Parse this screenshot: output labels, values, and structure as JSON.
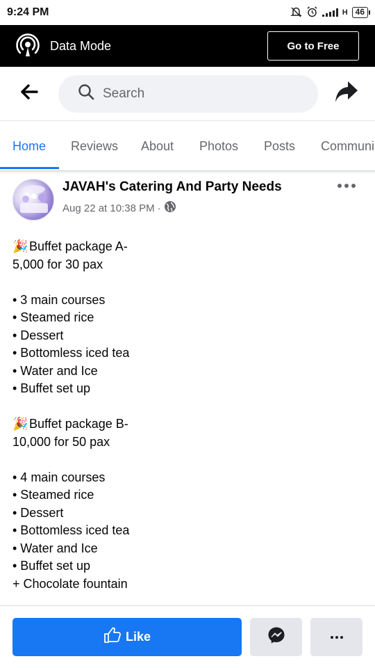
{
  "status_bar": {
    "time": "9:24 PM",
    "network": "H",
    "battery": "46",
    "icons": [
      "notifications-off-icon",
      "alarm-icon",
      "signal-icon"
    ]
  },
  "data_mode": {
    "label": "Data Mode",
    "go_free_label": "Go to Free",
    "icon": "broadcast-icon"
  },
  "nav": {
    "search_placeholder": "Search",
    "back_icon": "back-arrow-icon",
    "share_icon": "share-icon"
  },
  "tabs": [
    {
      "label": "Home",
      "active": true
    },
    {
      "label": "Reviews",
      "active": false
    },
    {
      "label": "About",
      "active": false
    },
    {
      "label": "Photos",
      "active": false
    },
    {
      "label": "Posts",
      "active": false
    },
    {
      "label": "Communi",
      "active": false
    }
  ],
  "post": {
    "author": "JAVAH's Catering And Party Needs",
    "timestamp": "Aug 22 at 10:38 PM",
    "separator": "·",
    "audience_icon": "globe-icon",
    "lines": [
      {
        "emoji": "🎉",
        "text": "Buffet package A-"
      },
      {
        "text": "5,000 for 30 pax"
      },
      {
        "text": ""
      },
      {
        "text": "• 3 main courses"
      },
      {
        "text": "• Steamed rice"
      },
      {
        "text": "• Dessert"
      },
      {
        "text": "• Bottomless iced tea"
      },
      {
        "text": "• Water and Ice"
      },
      {
        "text": "• Buffet set up"
      },
      {
        "text": ""
      },
      {
        "emoji": "🎉",
        "text": "Buffet package B-"
      },
      {
        "text": "10,000 for 50 pax"
      },
      {
        "text": ""
      },
      {
        "text": "• 4 main courses"
      },
      {
        "text": "• Steamed rice"
      },
      {
        "text": "• Dessert"
      },
      {
        "text": "• Bottomless iced tea"
      },
      {
        "text": "• Water and Ice"
      },
      {
        "text": "• Buffet set up"
      },
      {
        "text": "+ Chocolate fountain"
      }
    ]
  },
  "actions": {
    "like_label": "Like",
    "messenger_icon": "messenger-icon",
    "more_icon": "more-options-icon"
  },
  "colors": {
    "accent": "#1877f2",
    "secondary_text": "#65676b",
    "button_gray": "#e4e6eb",
    "data_bar_bg": "#000000"
  }
}
